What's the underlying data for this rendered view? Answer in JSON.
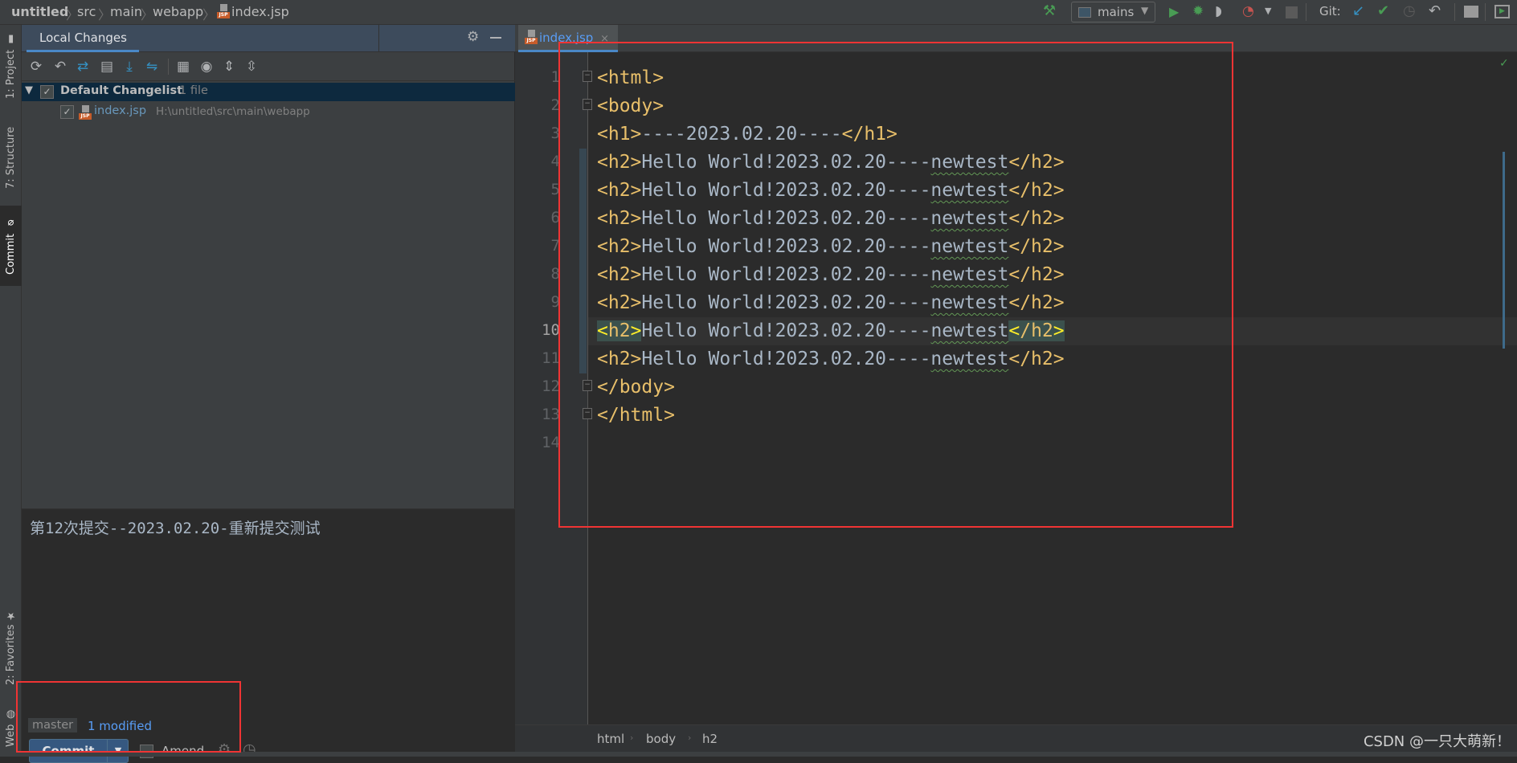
{
  "breadcrumb": [
    "untitled",
    "src",
    "main",
    "webapp",
    "index.jsp"
  ],
  "toolbar": {
    "run_config": "mains",
    "git_label": "Git:"
  },
  "left_strip": {
    "project": "1: Project",
    "structure": "7: Structure",
    "commit": "Commit",
    "favorites": "2: Favorites",
    "web": "Web"
  },
  "panel": {
    "tab": "Local Changes",
    "changelist": {
      "name": "Default Changelist",
      "count": "1 file",
      "checked": true
    },
    "file": {
      "name": "index.jsp",
      "path": "H:\\untitled\\src\\main\\webapp",
      "checked": true
    },
    "commit_message": "第12次提交--2023.02.20-重新提交测试",
    "branch": "master",
    "modified": "1 modified",
    "commit_button": "Commit",
    "amend_label": "Amend",
    "amend_checked": false
  },
  "editor": {
    "tab": "index.jsp",
    "current_line": 10,
    "lines": [
      "<html>",
      "<body>",
      "<h1>----2023.02.20----</h1>",
      "<h2>Hello World!2023.02.20----newtest</h2>",
      "<h2>Hello World!2023.02.20----newtest</h2>",
      "<h2>Hello World!2023.02.20----newtest</h2>",
      "<h2>Hello World!2023.02.20----newtest</h2>",
      "<h2>Hello World!2023.02.20----newtest</h2>",
      "<h2>Hello World!2023.02.20----newtest</h2>",
      "<h2>Hello World!2023.02.20----newtest</h2>",
      "<h2>Hello World!2023.02.20----newtest</h2>",
      "</body>",
      "</html>",
      ""
    ],
    "breadcrumb": [
      "html",
      "body",
      "h2"
    ]
  },
  "watermark": "CSDN @一只大萌新！",
  "colors": {
    "tag": "#e8bf6a",
    "text": "#a9b7c6",
    "accent": "#4a88c7",
    "annotation": "#f03434"
  }
}
